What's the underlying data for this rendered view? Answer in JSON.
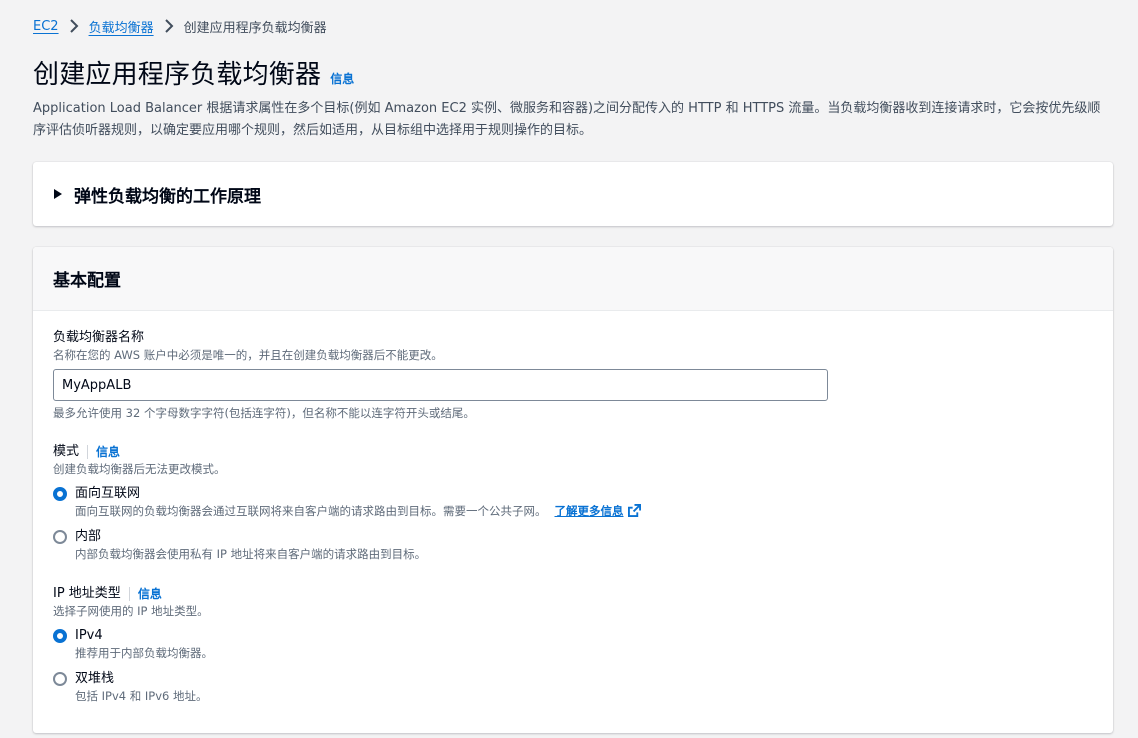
{
  "breadcrumb": {
    "items": [
      "EC2",
      "负载均衡器"
    ],
    "current": "创建应用程序负载均衡器"
  },
  "page": {
    "title": "创建应用程序负载均衡器",
    "info": "信息",
    "description": "Application Load Balancer 根据请求属性在多个目标(例如 Amazon EC2 实例、微服务和容器)之间分配传入的 HTTP 和 HTTPS 流量。当负载均衡器收到连接请求时，它会按优先级顺序评估侦听器规则，以确定要应用哪个规则，然后如适用，从目标组中选择用于规则操作的目标。"
  },
  "expandable": {
    "title": "弹性负载均衡的工作原理"
  },
  "basic_config": {
    "title": "基本配置",
    "name_field": {
      "label": "负载均衡器名称",
      "description": "名称在您的 AWS 账户中必须是唯一的，并且在创建负载均衡器后不能更改。",
      "value": "MyAppALB",
      "constraint": "最多允许使用 32 个字母数字字符(包括连字符)，但名称不能以连字符开头或结尾。"
    },
    "scheme": {
      "label": "模式",
      "info": "信息",
      "description": "创建负载均衡器后无法更改模式。",
      "options": [
        {
          "label": "面向互联网",
          "description": "面向互联网的负载均衡器会通过互联网将来自客户端的请求路由到目标。需要一个公共子网。",
          "link": "了解更多信息",
          "checked": true
        },
        {
          "label": "内部",
          "description": "内部负载均衡器会使用私有 IP 地址将来自客户端的请求路由到目标。",
          "checked": false
        }
      ]
    },
    "ip_type": {
      "label": "IP 地址类型",
      "info": "信息",
      "description": "选择子网使用的 IP 地址类型。",
      "options": [
        {
          "label": "IPv4",
          "description": "推荐用于内部负载均衡器。",
          "checked": true
        },
        {
          "label": "双堆栈",
          "description": "包括 IPv4 和 IPv6 地址。",
          "checked": false
        }
      ]
    }
  },
  "colors": {
    "link": "#0972d3",
    "text": "#000716",
    "muted": "#5f6b7a",
    "background": "#f3f3f4"
  }
}
